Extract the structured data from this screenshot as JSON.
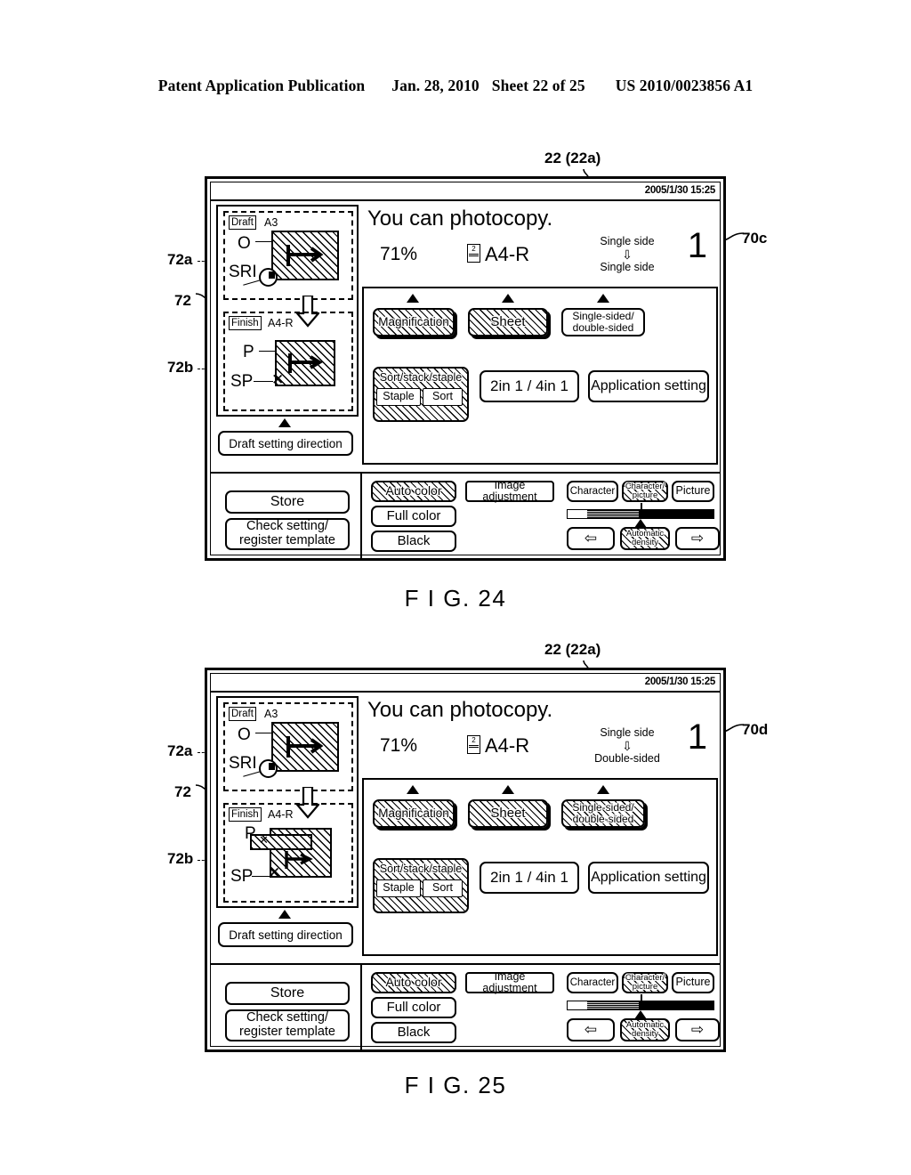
{
  "page": {
    "header_left": "Patent Application Publication",
    "header_date": "Jan. 28, 2010",
    "header_sheet": "Sheet 22 of 25",
    "header_patent_no": "US 2010/0023856 A1"
  },
  "figures": [
    {
      "caption": "F I G. 24",
      "callout_top": "22 (22a)",
      "callout_right": "70c",
      "callout_left_main": "72",
      "callout_left_upper": "72a",
      "callout_left_lower": "72b",
      "screen": {
        "clock": "2005/1/30 15:25",
        "message": "You can photocopy.",
        "zoom_percent": "71%",
        "paper_size": "A4-R",
        "tray_number": "2",
        "duplex_from": "Single side",
        "duplex_arrow": "⇩",
        "duplex_to": "Single side",
        "copy_count": "1",
        "preview": {
          "draft_label": "Draft",
          "draft_size": "A3",
          "draft_marker_o": "O",
          "draft_marker_sri": "SRI",
          "finish_label": "Finish",
          "finish_size": "A4-R",
          "finish_marker_p": "P",
          "finish_marker_sp": "SP",
          "finish_style": "single"
        },
        "direction_button": "Draft setting direction",
        "settings_row1": [
          {
            "label": "Magnification",
            "selected": true,
            "arrow": true
          },
          {
            "label": "Sheet",
            "selected": true,
            "arrow": true
          },
          {
            "label": "Single-sided/\ndouble-sided",
            "selected": false,
            "arrow": true
          }
        ],
        "settings_row2": [
          {
            "label": "Sort/stack/staple",
            "selected": true,
            "sub": [
              "Staple",
              "Sort"
            ]
          },
          {
            "label": "2in 1 / 4in 1",
            "selected": false
          },
          {
            "label": "Application  setting",
            "selected": false
          }
        ],
        "left_buttons": [
          {
            "label": "Store"
          },
          {
            "label": "Check setting/\nregister template"
          }
        ],
        "color_buttons": [
          {
            "label": "Auto color",
            "selected": true
          },
          {
            "label": "Full color",
            "selected": false
          },
          {
            "label": "Black",
            "selected": false
          }
        ],
        "image_adjust_button": "Image adjustment",
        "mode_buttons": [
          {
            "label": "Character",
            "selected": false
          },
          {
            "label": "Character/\npicture",
            "selected": true
          },
          {
            "label": "Picture",
            "selected": false
          }
        ],
        "density_buttons": [
          {
            "label": "⇦",
            "name": "density-decrease",
            "selected": false
          },
          {
            "label": "Automatic\ndensity",
            "name": "automatic-density",
            "selected": true
          },
          {
            "label": "⇨",
            "name": "density-increase",
            "selected": false
          }
        ],
        "density_slider_position_pct": 56
      }
    },
    {
      "caption": "F I G. 25",
      "callout_top": "22 (22a)",
      "callout_right": "70d",
      "callout_left_main": "72",
      "callout_left_upper": "72a",
      "callout_left_lower": "72b",
      "screen": {
        "clock": "2005/1/30 15:25",
        "message": "You can photocopy.",
        "zoom_percent": "71%",
        "paper_size": "A4-R",
        "tray_number": "2",
        "duplex_from": "Single side",
        "duplex_arrow": "⇩",
        "duplex_to": "Double-sided",
        "copy_count": "1",
        "preview": {
          "draft_label": "Draft",
          "draft_size": "A3",
          "draft_marker_o": "O",
          "draft_marker_sri": "SRI",
          "finish_label": "Finish",
          "finish_size": "A4-R",
          "finish_marker_p": "P",
          "finish_marker_sp": "SP",
          "finish_style": "double"
        },
        "direction_button": "Draft setting direction",
        "settings_row1": [
          {
            "label": "Magnification",
            "selected": true,
            "arrow": true
          },
          {
            "label": "Sheet",
            "selected": true,
            "arrow": true
          },
          {
            "label": "Single-sided/\ndouble-sided",
            "selected": true,
            "arrow": true
          }
        ],
        "settings_row2": [
          {
            "label": "Sort/stack/staple",
            "selected": true,
            "sub": [
              "Staple",
              "Sort"
            ]
          },
          {
            "label": "2in 1 / 4in 1",
            "selected": false
          },
          {
            "label": "Application  setting",
            "selected": false
          }
        ],
        "left_buttons": [
          {
            "label": "Store"
          },
          {
            "label": "Check setting/\nregister template"
          }
        ],
        "color_buttons": [
          {
            "label": "Auto color",
            "selected": true
          },
          {
            "label": "Full color",
            "selected": false
          },
          {
            "label": "Black",
            "selected": false
          }
        ],
        "image_adjust_button": "Image adjustment",
        "mode_buttons": [
          {
            "label": "Character",
            "selected": false
          },
          {
            "label": "Character/\npicture",
            "selected": true
          },
          {
            "label": "Picture",
            "selected": false
          }
        ],
        "density_buttons": [
          {
            "label": "⇦",
            "name": "density-decrease",
            "selected": false
          },
          {
            "label": "Automatic\ndensity",
            "name": "automatic-density",
            "selected": true
          },
          {
            "label": "⇨",
            "name": "density-increase",
            "selected": false
          }
        ],
        "density_slider_position_pct": 56
      }
    }
  ]
}
